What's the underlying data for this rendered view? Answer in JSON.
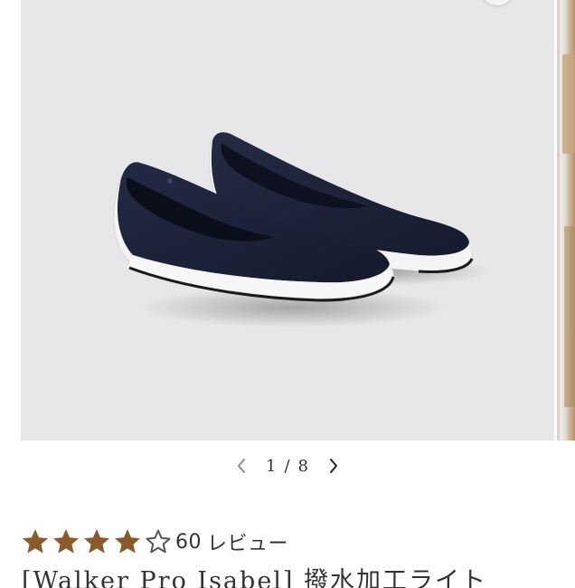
{
  "carousel": {
    "current": "1",
    "separator": "/",
    "total": "8"
  },
  "icons": {
    "prev": "chevron-left-icon",
    "next": "chevron-right-icon",
    "star_full": "star-filled-icon",
    "star_empty": "star-outline-icon"
  },
  "rating": {
    "value": 4,
    "max": 5,
    "review_count": "60",
    "review_label": "レビュー",
    "star_color": "#8b5a2b"
  },
  "product": {
    "title": "[Walker Pro Isabel] 撥水加工ライト"
  },
  "colors": {
    "image_background": "#e7e6e9",
    "shoe_upper": "#1c2238",
    "sole": "#f7f7f7"
  }
}
